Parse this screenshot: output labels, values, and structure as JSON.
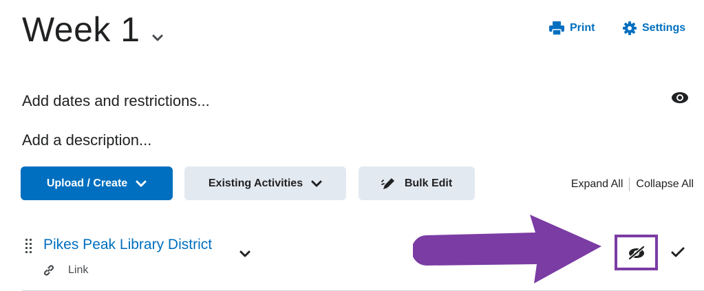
{
  "header": {
    "title": "Week 1",
    "print_label": "Print",
    "settings_label": "Settings"
  },
  "module": {
    "dates_text": "Add dates and restrictions...",
    "description_text": "Add a description..."
  },
  "toolbar": {
    "upload_label": "Upload / Create",
    "existing_label": "Existing Activities",
    "bulk_edit_label": "Bulk Edit",
    "expand_all": "Expand All",
    "collapse_all": "Collapse All"
  },
  "item": {
    "title": "Pikes Peak Library District",
    "type_label": "Link"
  },
  "colors": {
    "accent": "#006fbf",
    "highlight": "#7b3ca4",
    "secondary_button_bg": "#e3e9f1"
  },
  "icons": {
    "print": "print-icon",
    "settings": "gear-icon",
    "visibility": "eye-icon",
    "hidden": "eye-slash-icon",
    "drag": "drag-handle-icon",
    "link": "link-icon",
    "bulk_edit": "pencil-icon"
  }
}
